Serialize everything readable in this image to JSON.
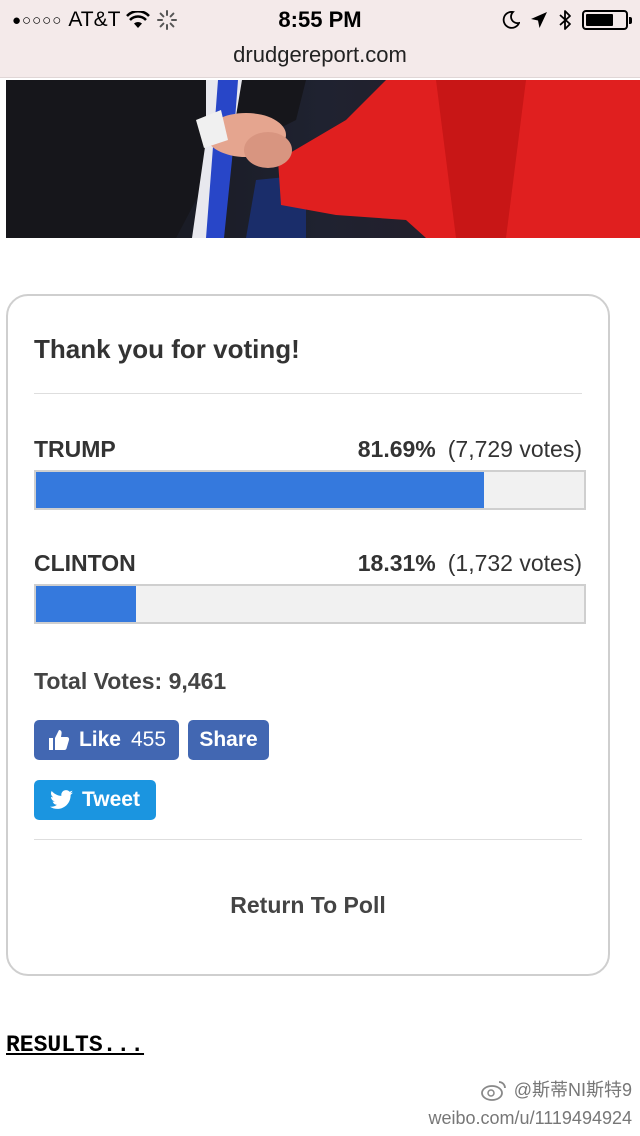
{
  "status_bar": {
    "signal_dots": "●○○○○",
    "carrier": "AT&T",
    "time": "8:55 PM"
  },
  "browser": {
    "url": "drudgereport.com"
  },
  "poll": {
    "title": "Thank you for voting!",
    "candidates": [
      {
        "name": "TRUMP",
        "percent": "81.69%",
        "votes": "(7,729 votes)",
        "share": 0.8169
      },
      {
        "name": "CLINTON",
        "percent": "18.31%",
        "votes": "(1,732 votes)",
        "share": 0.1831
      }
    ],
    "total_votes": "Total Votes: 9,461",
    "bar_color": "#3579dd",
    "like_label": "Like",
    "like_count": "455",
    "share_label": "Share",
    "tweet_label": "Tweet",
    "return_label": "Return To Poll"
  },
  "results_link": "RESULTS...",
  "watermark": {
    "user": "@斯蒂NI斯特9",
    "url": "weibo.com/u/1119494924"
  },
  "colors": {
    "facebook": "#4267b2",
    "twitter": "#1b95e0"
  }
}
